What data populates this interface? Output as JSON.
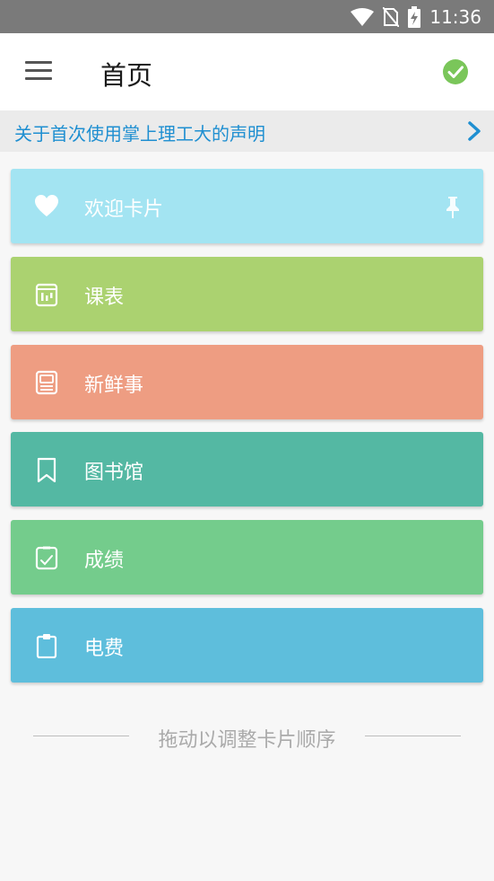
{
  "status_bar": {
    "time": "11:36"
  },
  "app_bar": {
    "title": "首页"
  },
  "notice": {
    "text": "关于首次使用掌上理工大的声明"
  },
  "cards": [
    {
      "label": "欢迎卡片",
      "color": "#a3e4f2",
      "icon": "heart-icon"
    },
    {
      "label": "课表",
      "color": "#abd270",
      "icon": "calendar-icon"
    },
    {
      "label": "新鲜事",
      "color": "#ee9d82",
      "icon": "news-icon"
    },
    {
      "label": "图书馆",
      "color": "#54b8a3",
      "icon": "bookmark-icon"
    },
    {
      "label": "成绩",
      "color": "#74cc8c",
      "icon": "grade-check-icon"
    },
    {
      "label": "电费",
      "color": "#5ebedc",
      "icon": "clipboard-icon"
    }
  ],
  "footer": {
    "hint": "拖动以调整卡片顺序"
  },
  "colors": {
    "accent_blue": "#1f8fd1",
    "check_green": "#7ac65a"
  }
}
